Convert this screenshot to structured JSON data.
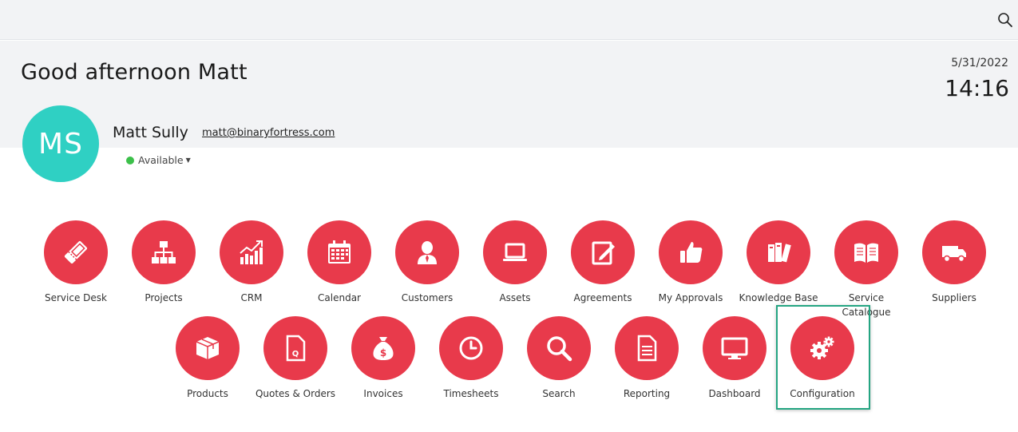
{
  "topbar": {
    "search_icon": "search-icon"
  },
  "header": {
    "greeting": "Good afternoon Matt",
    "date": "5/31/2022",
    "time": "14:16"
  },
  "user": {
    "initials": "MS",
    "name": "Matt Sully",
    "email": "matt@binaryfortress.com",
    "status": "Available",
    "avatar_color": "#2fd0c3",
    "status_color": "#3cc04a"
  },
  "accent_color": "#e83a4b",
  "highlight_color": "#24a582",
  "tiles_row1": [
    {
      "label": "Service Desk",
      "icon": "ticket-icon"
    },
    {
      "label": "Projects",
      "icon": "hierarchy-icon"
    },
    {
      "label": "CRM",
      "icon": "growth-chart-icon"
    },
    {
      "label": "Calendar",
      "icon": "calendar-icon"
    },
    {
      "label": "Customers",
      "icon": "person-icon"
    },
    {
      "label": "Assets",
      "icon": "laptop-icon"
    },
    {
      "label": "Agreements",
      "icon": "document-pen-icon"
    },
    {
      "label": "My Approvals",
      "icon": "thumbs-up-icon"
    },
    {
      "label": "Knowledge Base",
      "icon": "books-icon"
    },
    {
      "label": "Service Catalogue",
      "icon": "open-book-icon"
    },
    {
      "label": "Suppliers",
      "icon": "truck-icon"
    }
  ],
  "tiles_row2": [
    {
      "label": "Products",
      "icon": "box-icon"
    },
    {
      "label": "Quotes & Orders",
      "icon": "quote-document-icon"
    },
    {
      "label": "Invoices",
      "icon": "money-bag-icon"
    },
    {
      "label": "Timesheets",
      "icon": "clock-icon"
    },
    {
      "label": "Search",
      "icon": "magnifier-icon"
    },
    {
      "label": "Reporting",
      "icon": "report-icon"
    },
    {
      "label": "Dashboard",
      "icon": "monitor-icon"
    },
    {
      "label": "Configuration",
      "icon": "gears-icon"
    }
  ]
}
